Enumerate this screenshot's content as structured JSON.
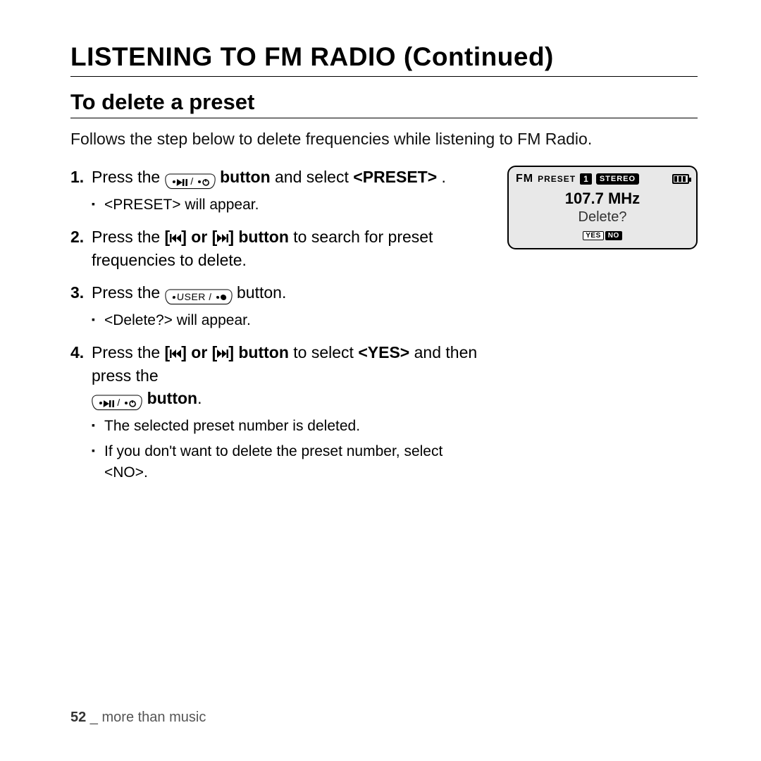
{
  "title": "LISTENING TO FM RADIO (Continued)",
  "section": "To delete a preset",
  "intro": "Follows the step below to delete frequencies while listening to FM Radio.",
  "steps": {
    "s1": {
      "num": "1.",
      "a": "Press the ",
      "b": " button",
      "c": " and select ",
      "d": "<PRESET>",
      "e": "."
    },
    "s1sub": "<PRESET> will appear.",
    "s2": {
      "num": "2.",
      "a": "Press the ",
      "b": "[",
      "c": "] or [",
      "d": "] button",
      "e": " to search for preset frequencies to delete."
    },
    "s3": {
      "num": "3.",
      "a": "Press the ",
      "b": " button."
    },
    "s3sub": "<Delete?> will appear.",
    "s4": {
      "num": "4.",
      "a": "Press the ",
      "b": "[",
      "c": "] or [",
      "d": "] button",
      "e": " to select ",
      "f": "<YES>",
      "g": " and then press the ",
      "h": " button",
      "i": "."
    },
    "s4sub1": "The selected preset number is deleted.",
    "s4sub2": "If you don't want to delete the preset number, select <NO>."
  },
  "radio": {
    "fm": "FM",
    "preset": "PRESET",
    "num": "1",
    "stereo": "STEREO",
    "freq": "107.7 MHz",
    "prompt": "Delete?",
    "yes": "YES",
    "no": "NO"
  },
  "footer": {
    "page": "52",
    "sep": " _ ",
    "label": "more than music"
  }
}
